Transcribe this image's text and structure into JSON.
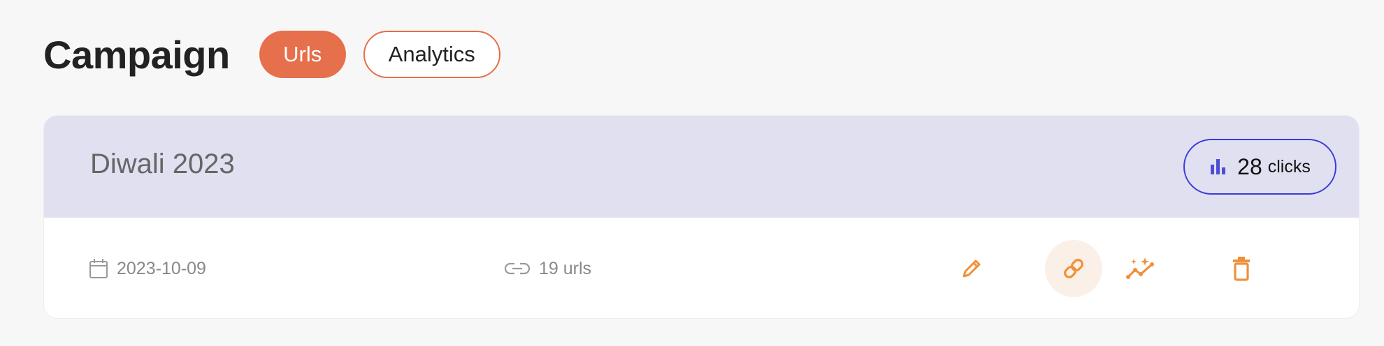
{
  "page": {
    "title": "Campaign",
    "tabs": [
      {
        "label": "Urls",
        "active": true
      },
      {
        "label": "Analytics",
        "active": false
      }
    ]
  },
  "campaign": {
    "name": "Diwali 2023",
    "clicks_count": "28",
    "clicks_label": "clicks",
    "date": "2023-10-09",
    "urls": "19 urls",
    "actions": [
      "edit-icon",
      "link-icon",
      "analytics-sparkle-icon",
      "trash-icon"
    ]
  },
  "colors": {
    "accent": "#e66f4c",
    "icon_orange": "#f0913a",
    "header_bg": "#e1e0f0",
    "clicks_border": "#3b3bdc",
    "chart_icon": "#4d4dd6"
  }
}
